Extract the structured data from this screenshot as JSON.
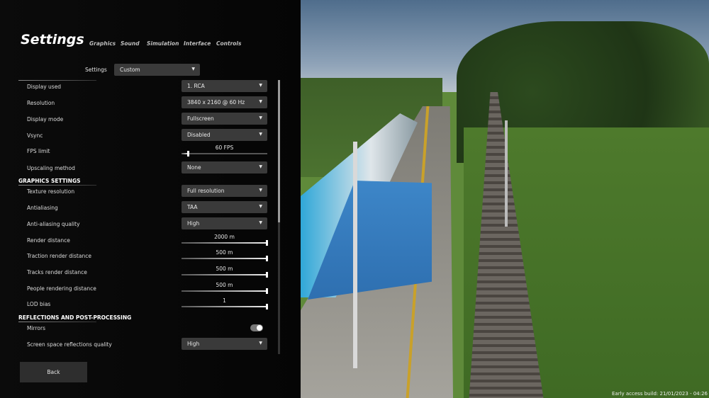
{
  "header": {
    "title": "Settings",
    "tabs": [
      "Graphics",
      "Sound",
      "Simulation",
      "Interface",
      "Controls"
    ]
  },
  "preset": {
    "label": "Settings",
    "value": "Custom"
  },
  "display_rows": [
    {
      "label": "Display used",
      "type": "dropdown",
      "value": "1. RCA"
    },
    {
      "label": "Resolution",
      "type": "dropdown",
      "value": "3840 x 2160 @ 60 Hz"
    },
    {
      "label": "Display mode",
      "type": "dropdown",
      "value": "Fullscreen"
    },
    {
      "label": "Vsync",
      "type": "dropdown",
      "value": "Disabled"
    },
    {
      "label": "FPS limit",
      "type": "slider",
      "value": "60 FPS",
      "level": 0.08
    },
    {
      "label": "Upscaling method",
      "type": "dropdown",
      "value": "None"
    }
  ],
  "graphics": {
    "heading": "GRAPHICS SETTINGS",
    "rows": [
      {
        "label": "Texture resolution",
        "type": "dropdown",
        "value": "Full resolution"
      },
      {
        "label": "Antialiasing",
        "type": "dropdown",
        "value": "TAA"
      },
      {
        "label": "Anti-aliasing quality",
        "type": "dropdown",
        "value": "High"
      },
      {
        "label": "Render distance",
        "type": "slider",
        "value": "2000 m",
        "level": 1.0
      },
      {
        "label": "Traction render distance",
        "type": "slider",
        "value": "500 m",
        "level": 1.0
      },
      {
        "label": "Tracks render distance",
        "type": "slider",
        "value": "500 m",
        "level": 1.0
      },
      {
        "label": "People rendering distance",
        "type": "slider",
        "value": "500 m",
        "level": 1.0
      },
      {
        "label": "LOD bias",
        "type": "slider",
        "value": "1",
        "level": 1.0
      }
    ]
  },
  "reflections": {
    "heading": "REFLECTIONS AND POST-PROCESSING",
    "rows": [
      {
        "label": "Mirrors",
        "type": "toggle",
        "on": true
      },
      {
        "label": "Screen space reflections quality",
        "type": "dropdown",
        "value": "High"
      }
    ]
  },
  "scrollbar": {
    "thumb_fraction": 0.52,
    "position": 0.0
  },
  "back_button": "Back",
  "build_info": "Early access build: 21/01/2023 - 04:26",
  "colors": {
    "panel": "#080808",
    "dropdown": "#3a3a3a",
    "shelter": "#3d86c8",
    "train_accent": "#2fa7d8"
  }
}
